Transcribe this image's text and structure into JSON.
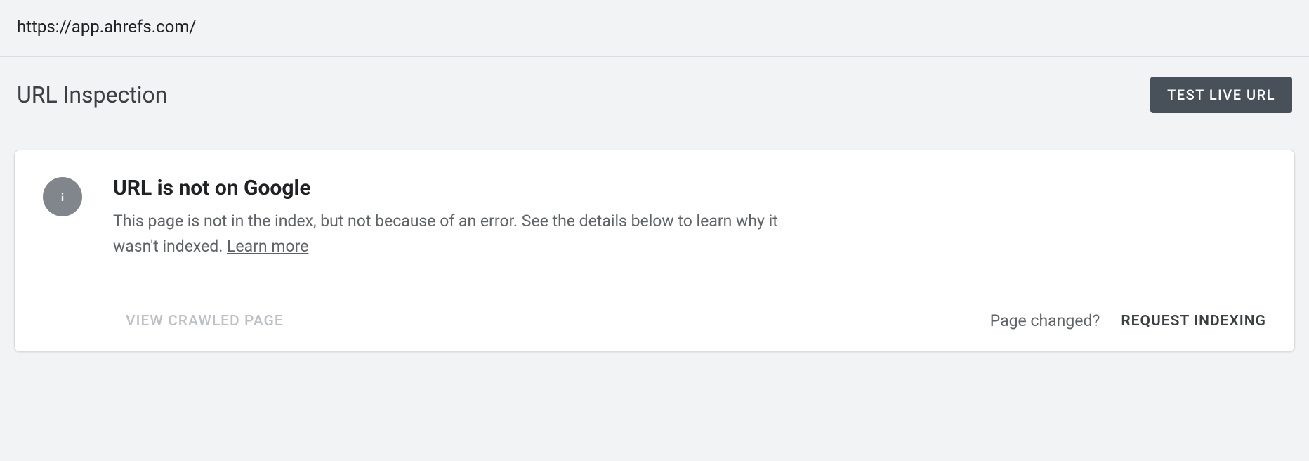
{
  "url_bar": {
    "url": "https://app.ahrefs.com/"
  },
  "header": {
    "title": "URL Inspection",
    "test_live_url_label": "TEST LIVE URL"
  },
  "status_card": {
    "icon": "info-icon",
    "heading": "URL is not on Google",
    "description": "This page is not in the index, but not because of an error. See the details below to learn why it wasn't indexed. ",
    "learn_more_label": "Learn more",
    "view_crawled_label": "VIEW CRAWLED PAGE",
    "page_changed_label": "Page changed?",
    "request_indexing_label": "REQUEST INDEXING"
  }
}
